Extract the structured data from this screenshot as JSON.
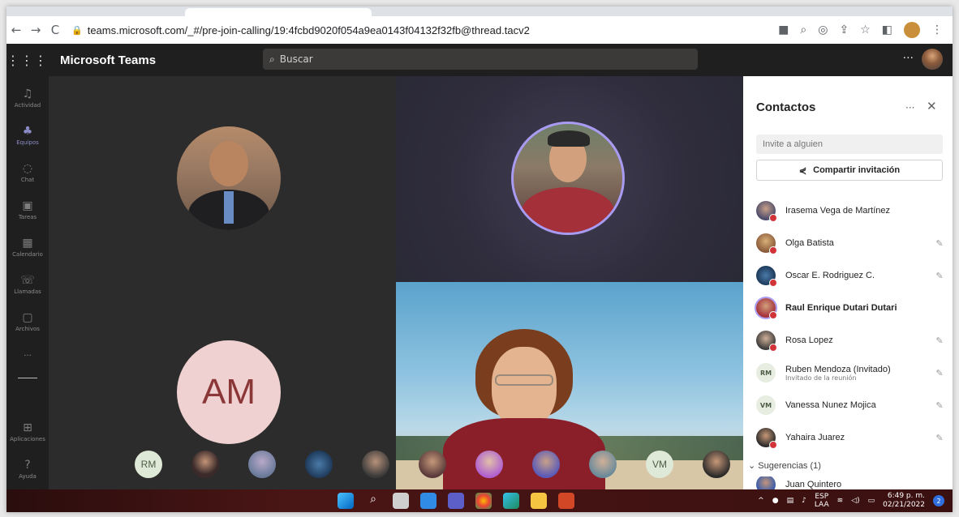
{
  "browser": {
    "url": "teams.microsoft.com/_#/pre-join-calling/19:4fcbd9020f054a9ea0143f04132f32fb@thread.tacv2"
  },
  "header": {
    "app_title": "Microsoft Teams",
    "search_placeholder": "Buscar",
    "more": "···"
  },
  "rail": {
    "items": [
      {
        "label": "Actividad",
        "icon": "bell-icon"
      },
      {
        "label": "Equipos",
        "icon": "teams-icon"
      },
      {
        "label": "Chat",
        "icon": "chat-icon"
      },
      {
        "label": "Tareas",
        "icon": "tasks-icon"
      },
      {
        "label": "Calendario",
        "icon": "calendar-icon"
      },
      {
        "label": "Llamadas",
        "icon": "phone-icon"
      },
      {
        "label": "Archivos",
        "icon": "files-icon"
      },
      {
        "label": "···",
        "icon": "more-icon"
      },
      {
        "label": "Aplicaciones",
        "icon": "apps-icon"
      },
      {
        "label": "Ayuda",
        "icon": "help-icon"
      }
    ]
  },
  "stage": {
    "am_initials": "AM",
    "mini_initials_1": "RM",
    "mini_initials_2": "VM"
  },
  "panel": {
    "title": "Contactos",
    "more": "···",
    "close": "✕",
    "invite_placeholder": "Invite a alguien",
    "share_label": "Compartir invitación",
    "contacts": [
      {
        "name": "Irasema Vega de Martínez",
        "sub": "",
        "muted": false
      },
      {
        "name": "Olga Batista",
        "sub": "",
        "muted": true
      },
      {
        "name": "Oscar E. Rodriguez C.",
        "sub": "",
        "muted": true
      },
      {
        "name": "Raul Enrique Dutari Dutari",
        "sub": "",
        "muted": false
      },
      {
        "name": "Rosa Lopez",
        "sub": "",
        "muted": true
      },
      {
        "name": "Ruben Mendoza (Invitado)",
        "sub": "Invitado de la reunión",
        "muted": true,
        "initials": "RM"
      },
      {
        "name": "Vanessa Nunez Mojica",
        "sub": "",
        "muted": true,
        "initials": "VM"
      },
      {
        "name": "Yahaira Juarez",
        "sub": "",
        "muted": true
      }
    ],
    "suggestions_label": "Sugerencias (1)",
    "suggestion_name": "Juan Quintero"
  },
  "taskbar": {
    "lang_1": "ESP",
    "lang_2": "LAA",
    "time": "6:49 p. m.",
    "date": "02/21/2022",
    "notifications": "2"
  },
  "colors": {
    "accent": "#6264a7",
    "speaking_ring": "#a99bf2",
    "presence_busy": "#d13438"
  }
}
